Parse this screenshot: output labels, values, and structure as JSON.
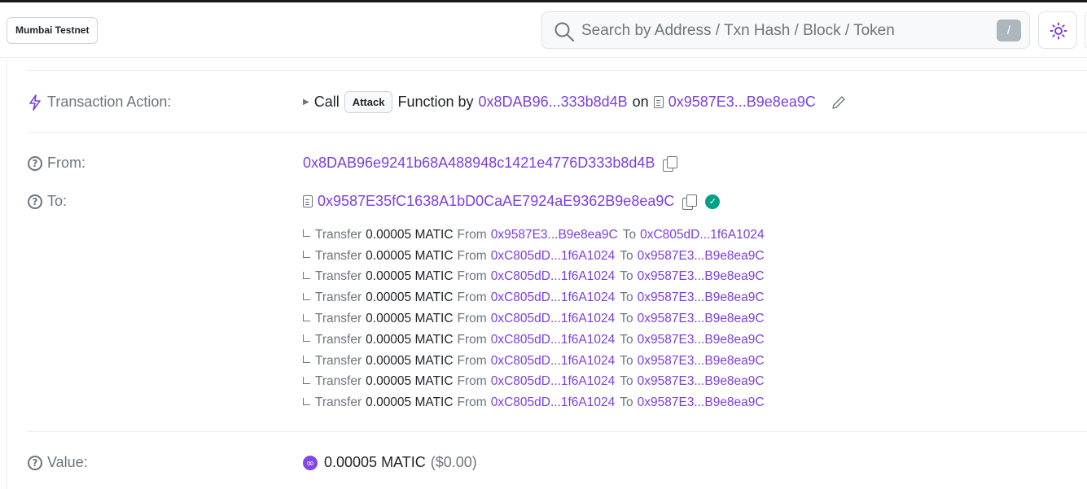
{
  "header": {
    "network_label": "Mumbai Testnet",
    "search_placeholder": "Search by Address / Txn Hash / Block / Token",
    "search_shortcut": "/"
  },
  "transaction_action": {
    "label": "Transaction Action:",
    "call_word": "Call",
    "method": "Attack",
    "function_by": "Function by",
    "caller": "0x8DAB96...333b8d4B",
    "on_word": "on",
    "contract": "0x9587E3...B9e8ea9C"
  },
  "from": {
    "label": "From:",
    "address": "0x8DAB96e9241b68A488948c1421e4776D333b8d4B"
  },
  "to": {
    "label": "To:",
    "address": "0x9587E35fC1638A1bD0CaAE7924aE9362B9e8ea9C"
  },
  "transfers": [
    {
      "word": "Transfer",
      "amount": "0.00005 MATIC",
      "from_word": "From",
      "from": "0x9587E3...B9e8ea9C",
      "to_word": "To",
      "to": "0xC805dD...1f6A1024"
    },
    {
      "word": "Transfer",
      "amount": "0.00005 MATIC",
      "from_word": "From",
      "from": "0xC805dD...1f6A1024",
      "to_word": "To",
      "to": "0x9587E3...B9e8ea9C"
    },
    {
      "word": "Transfer",
      "amount": "0.00005 MATIC",
      "from_word": "From",
      "from": "0xC805dD...1f6A1024",
      "to_word": "To",
      "to": "0x9587E3...B9e8ea9C"
    },
    {
      "word": "Transfer",
      "amount": "0.00005 MATIC",
      "from_word": "From",
      "from": "0xC805dD...1f6A1024",
      "to_word": "To",
      "to": "0x9587E3...B9e8ea9C"
    },
    {
      "word": "Transfer",
      "amount": "0.00005 MATIC",
      "from_word": "From",
      "from": "0xC805dD...1f6A1024",
      "to_word": "To",
      "to": "0x9587E3...B9e8ea9C"
    },
    {
      "word": "Transfer",
      "amount": "0.00005 MATIC",
      "from_word": "From",
      "from": "0xC805dD...1f6A1024",
      "to_word": "To",
      "to": "0x9587E3...B9e8ea9C"
    },
    {
      "word": "Transfer",
      "amount": "0.00005 MATIC",
      "from_word": "From",
      "from": "0xC805dD...1f6A1024",
      "to_word": "To",
      "to": "0x9587E3...B9e8ea9C"
    },
    {
      "word": "Transfer",
      "amount": "0.00005 MATIC",
      "from_word": "From",
      "from": "0xC805dD...1f6A1024",
      "to_word": "To",
      "to": "0x9587E3...B9e8ea9C"
    },
    {
      "word": "Transfer",
      "amount": "0.00005 MATIC",
      "from_word": "From",
      "from": "0xC805dD...1f6A1024",
      "to_word": "To",
      "to": "0x9587E3...B9e8ea9C"
    }
  ],
  "value": {
    "label": "Value:",
    "amount": "0.00005 MATIC",
    "usd": "($0.00)"
  },
  "colors": {
    "link": "#7b3fe4",
    "verified": "#00a186",
    "matic": "#8247e5"
  }
}
